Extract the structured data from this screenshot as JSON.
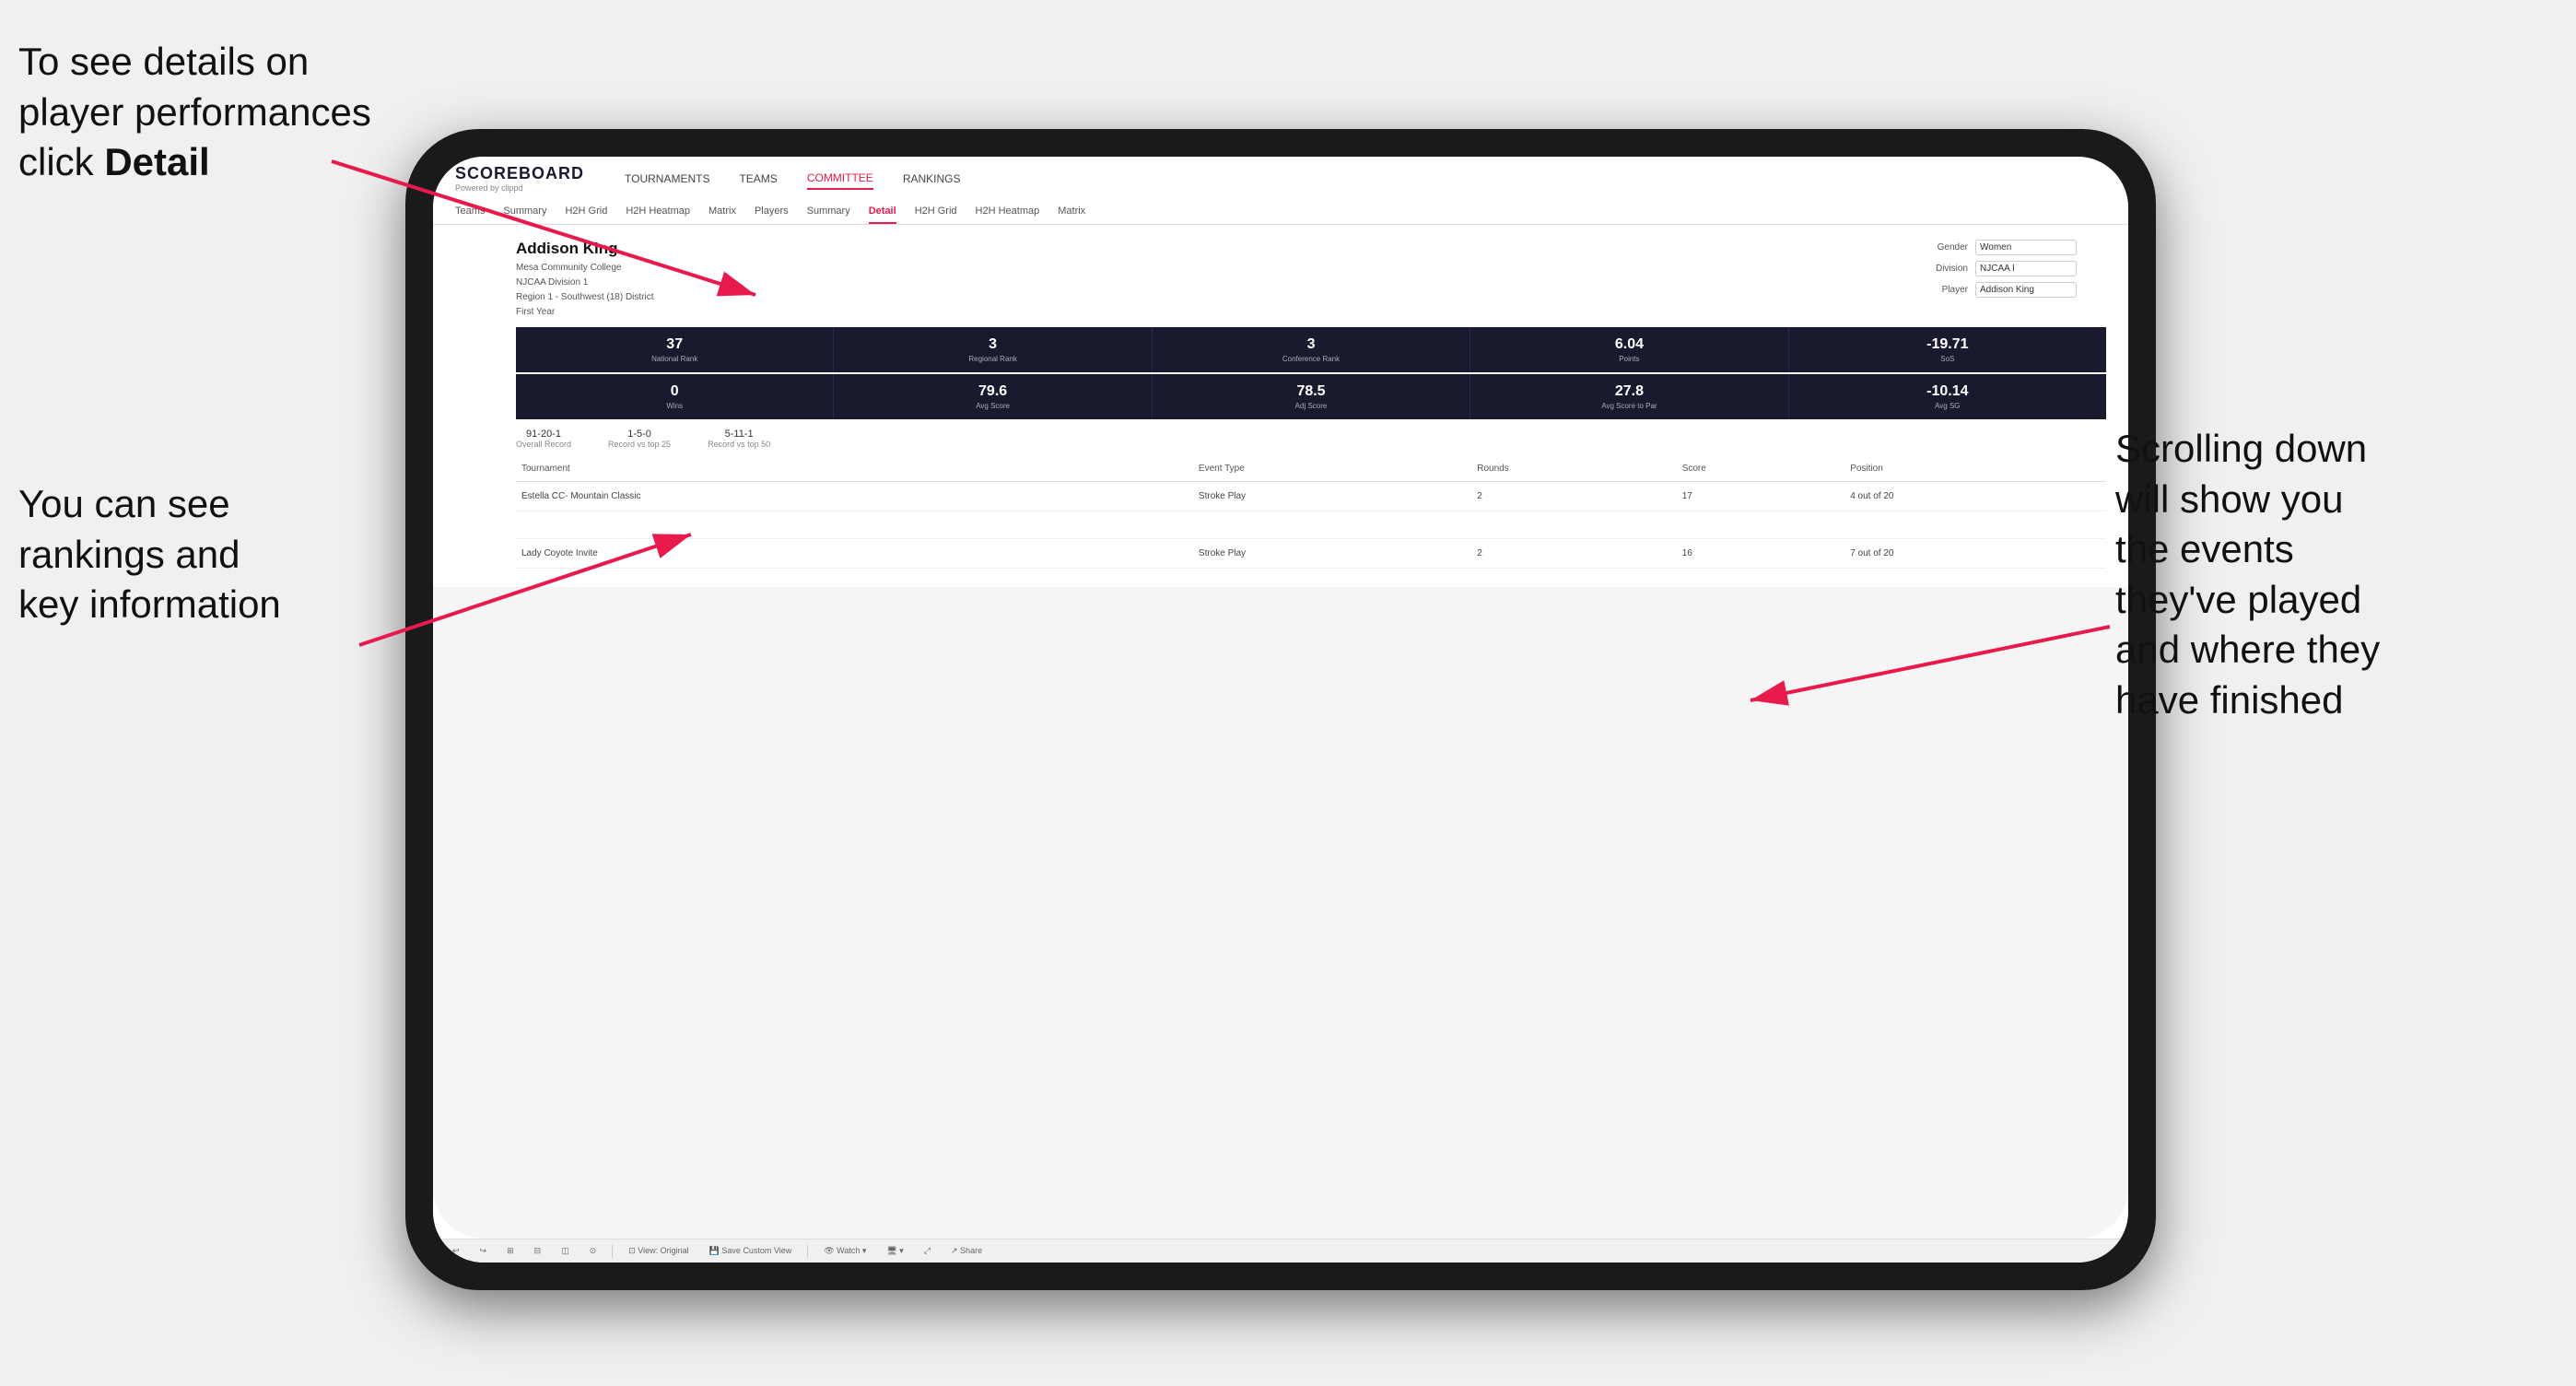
{
  "annotations": {
    "top_left_line1": "To see details on",
    "top_left_line2": "player performances",
    "top_left_line3_plain": "click ",
    "top_left_line3_bold": "Detail",
    "bottom_left_line1": "You can see",
    "bottom_left_line2": "rankings and",
    "bottom_left_line3": "key information",
    "right_line1": "Scrolling down",
    "right_line2": "will show you",
    "right_line3": "the events",
    "right_line4": "they've played",
    "right_line5": "and where they",
    "right_line6": "have finished"
  },
  "header": {
    "logo": "SCOREBOARD",
    "logo_sub": "Powered by clippd",
    "nav": [
      "TOURNAMENTS",
      "TEAMS",
      "COMMITTEE",
      "RANKINGS"
    ]
  },
  "subnav": {
    "items": [
      "Teams",
      "Summary",
      "H2H Grid",
      "H2H Heatmap",
      "Matrix",
      "Players",
      "Summary",
      "Detail",
      "H2H Grid",
      "H2H Heatmap",
      "Matrix"
    ],
    "active": "Detail"
  },
  "player": {
    "name": "Addison King",
    "school": "Mesa Community College",
    "division": "NJCAA Division 1",
    "region": "Region 1 - Southwest (18) District",
    "year": "First Year"
  },
  "filters": {
    "gender_label": "Gender",
    "gender_value": "Women",
    "division_label": "Division",
    "division_value": "NJCAA I",
    "player_label": "Player",
    "player_value": "Addison King"
  },
  "stats_row1": [
    {
      "value": "37",
      "label": "National Rank"
    },
    {
      "value": "3",
      "label": "Regional Rank"
    },
    {
      "value": "3",
      "label": "Conference Rank"
    },
    {
      "value": "6.04",
      "label": "Points"
    },
    {
      "value": "-19.71",
      "label": "SoS"
    }
  ],
  "stats_row2": [
    {
      "value": "0",
      "label": "Wins"
    },
    {
      "value": "79.6",
      "label": "Avg Score"
    },
    {
      "value": "78.5",
      "label": "Adj Score"
    },
    {
      "value": "27.8",
      "label": "Avg Score to Par"
    },
    {
      "value": "-10.14",
      "label": "Avg SG"
    }
  ],
  "records": [
    {
      "value": "91-20-1",
      "label": "Overall Record"
    },
    {
      "value": "1-5-0",
      "label": "Record vs top 25"
    },
    {
      "value": "5-11-1",
      "label": "Record vs top 50"
    }
  ],
  "table": {
    "headers": [
      "Tournament",
      "",
      "Event Type",
      "Rounds",
      "Score",
      "Position"
    ],
    "rows": [
      {
        "tournament": "Estella CC- Mountain Classic",
        "event_type": "Stroke Play",
        "rounds": "2",
        "score": "17",
        "position": "4 out of 20"
      },
      {
        "tournament": "",
        "event_type": "",
        "rounds": "",
        "score": "",
        "position": ""
      },
      {
        "tournament": "Lady Coyote Invite",
        "event_type": "Stroke Play",
        "rounds": "2",
        "score": "16",
        "position": "7 out of 20"
      }
    ]
  },
  "toolbar": {
    "items": [
      "↩",
      "↪",
      "⊞",
      "⊟",
      "◫−+",
      "⊙",
      "View: Original",
      "Save Custom View",
      "👁 Watch ▾",
      "🖥 ▾",
      "⤢",
      "Share"
    ]
  }
}
